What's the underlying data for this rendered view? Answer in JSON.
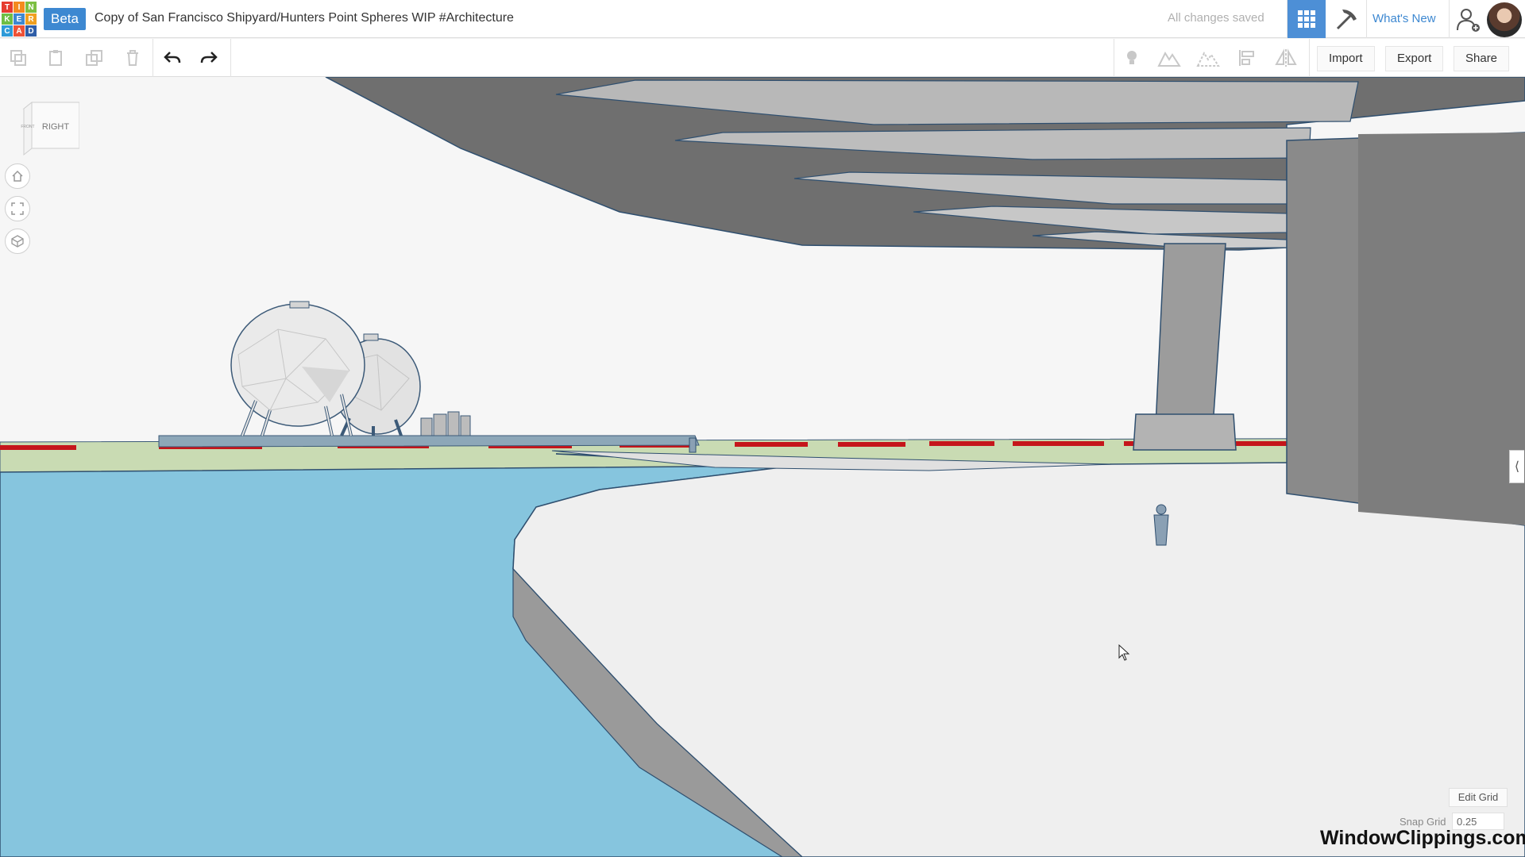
{
  "app": {
    "logo_letters": [
      "T",
      "I",
      "N",
      "K",
      "E",
      "R",
      "C",
      "A",
      "D"
    ],
    "logo_colors": [
      "#e63c2f",
      "#f48a1f",
      "#7cbf42",
      "#6ebe44",
      "#3d88d1",
      "#f0a020",
      "#2e9ad8",
      "#ee5237",
      "#2f5ea8"
    ],
    "beta_label": "Beta",
    "document_title": "Copy of San Francisco Shipyard/Hunters Point Spheres WIP #Architecture",
    "save_status": "All changes saved",
    "whats_new_label": "What's New",
    "accent_color": "#4d8fd6"
  },
  "toolbar": {
    "left_icons": [
      "copy-icon",
      "paste-icon",
      "duplicate-icon",
      "delete-icon",
      "undo-icon",
      "redo-icon"
    ],
    "right_icons": [
      "light-bulb-icon",
      "solid-shape-icon",
      "hole-shape-icon",
      "align-icon",
      "mirror-icon"
    ],
    "import_label": "Import",
    "export_label": "Export",
    "share_label": "Share"
  },
  "viewcube": {
    "front_label": "FRONT",
    "right_label": "RIGHT"
  },
  "nav_controls": [
    "home-view-icon",
    "fit-view-icon",
    "perspective-icon"
  ],
  "grid": {
    "edit_grid_label": "Edit Grid",
    "snap_grid_label": "Snap Grid",
    "snap_grid_value": "0.25"
  },
  "scene": {
    "water_color": "#86c5de",
    "ground_color": "#c7d9b1",
    "stripe_color": "#c5151b",
    "platform_color": "#efefef",
    "structure_color": "#7a7a7a"
  },
  "watermark": "WindowClippings.com"
}
